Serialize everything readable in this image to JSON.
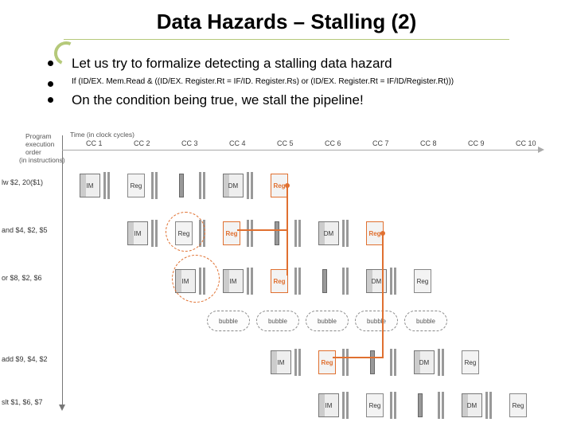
{
  "title": "Data Hazards – Stalling (2)",
  "bullets": {
    "b1": "Let us try to formalize detecting a stalling data hazard",
    "b2": "If (ID/EX. Mem.Read & ((ID/EX. Register.Rt = IF/ID. Register.Rs) or (ID/EX. Register.Rt = IF/ID/Register.Rt)))",
    "b3": "On the condition being true, we stall the pipeline!"
  },
  "axis": {
    "program": "Program",
    "execution": "execution",
    "order": "order",
    "instructions": "(in instructions)",
    "time": "Time (in clock cycles)"
  },
  "cc": [
    "CC 1",
    "CC 2",
    "CC 3",
    "CC 4",
    "CC 5",
    "CC 6",
    "CC 7",
    "CC 8",
    "CC 9",
    "CC 10"
  ],
  "stages": {
    "IM": "IM",
    "Reg": "Reg",
    "DM": "DM"
  },
  "bubble_lbl": "bubble",
  "instr": {
    "i1": "lw $2, 20($1)",
    "i2": "and $4, $2, $5",
    "i3": "or $8, $2, $6",
    "i4": "add $9, $4, $2",
    "i5": "slt $1, $6, $7"
  }
}
